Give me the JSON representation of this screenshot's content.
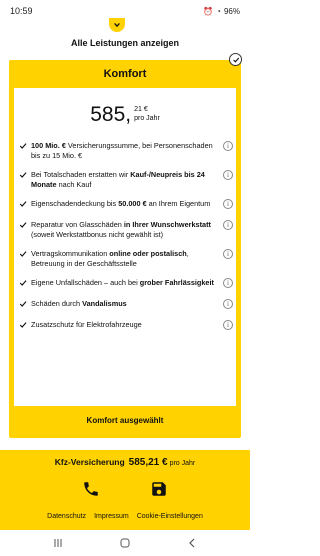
{
  "status": {
    "time": "10:59",
    "battery": "96%"
  },
  "header": {
    "show_all_label": "Alle Leistungen anzeigen"
  },
  "card": {
    "title": "Komfort",
    "price_main": "585,",
    "price_cents": "21 €",
    "price_period": "pro Jahr",
    "selected_label": "Komfort ausgewählt",
    "features": [
      {
        "parts": [
          {
            "t": "100 Mio. €",
            "b": true
          },
          {
            "t": " Versicherungssumme, bei Perso­nenschaden bis zu 15 Mio. €",
            "b": false
          }
        ]
      },
      {
        "parts": [
          {
            "t": "Bei Totalschaden erstatten wir ",
            "b": false
          },
          {
            "t": "Kauf-/Neu­preis bis 24 Monate",
            "b": true
          },
          {
            "t": " nach Kauf",
            "b": false
          }
        ]
      },
      {
        "parts": [
          {
            "t": "Eigenschadendeckung bis ",
            "b": false
          },
          {
            "t": "50.000 €",
            "b": true
          },
          {
            "t": " an Ih­rem Eigentum",
            "b": false
          }
        ]
      },
      {
        "parts": [
          {
            "t": "Reparatur von Glasschäden ",
            "b": false
          },
          {
            "t": "in Ihrer Wunschwerkstatt",
            "b": true
          },
          {
            "t": " (soweit Werkstattbonus nicht gewählt ist)",
            "b": false
          }
        ]
      },
      {
        "parts": [
          {
            "t": "Vertragskommunikation ",
            "b": false
          },
          {
            "t": "online oder posta­lisch",
            "b": true
          },
          {
            "t": ", Betreuung in der Geschäftsstelle",
            "b": false
          }
        ]
      },
      {
        "parts": [
          {
            "t": "Eigene Unfallschäden – auch bei ",
            "b": false
          },
          {
            "t": "grober Fahrlässigkeit",
            "b": true
          }
        ]
      },
      {
        "parts": [
          {
            "t": "Schäden durch ",
            "b": false
          },
          {
            "t": "Vandalismus",
            "b": true
          }
        ]
      },
      {
        "parts": [
          {
            "t": "Zusatzschutz für Elektrofahrzeuge",
            "b": false
          }
        ]
      }
    ]
  },
  "bottom": {
    "product": "Kfz-Versicherung",
    "total": "585,21 €",
    "period": "pro Jahr",
    "links": [
      "Datenschutz",
      "Impressum",
      "Cookie-Einstellungen"
    ]
  },
  "colors": {
    "accent": "#ffd200"
  },
  "icons": [
    "chevron-down-icon",
    "check-circle-icon",
    "check-icon",
    "info-icon",
    "phone-icon",
    "save-icon",
    "nav-recents-icon",
    "nav-home-icon",
    "nav-back-icon"
  ]
}
